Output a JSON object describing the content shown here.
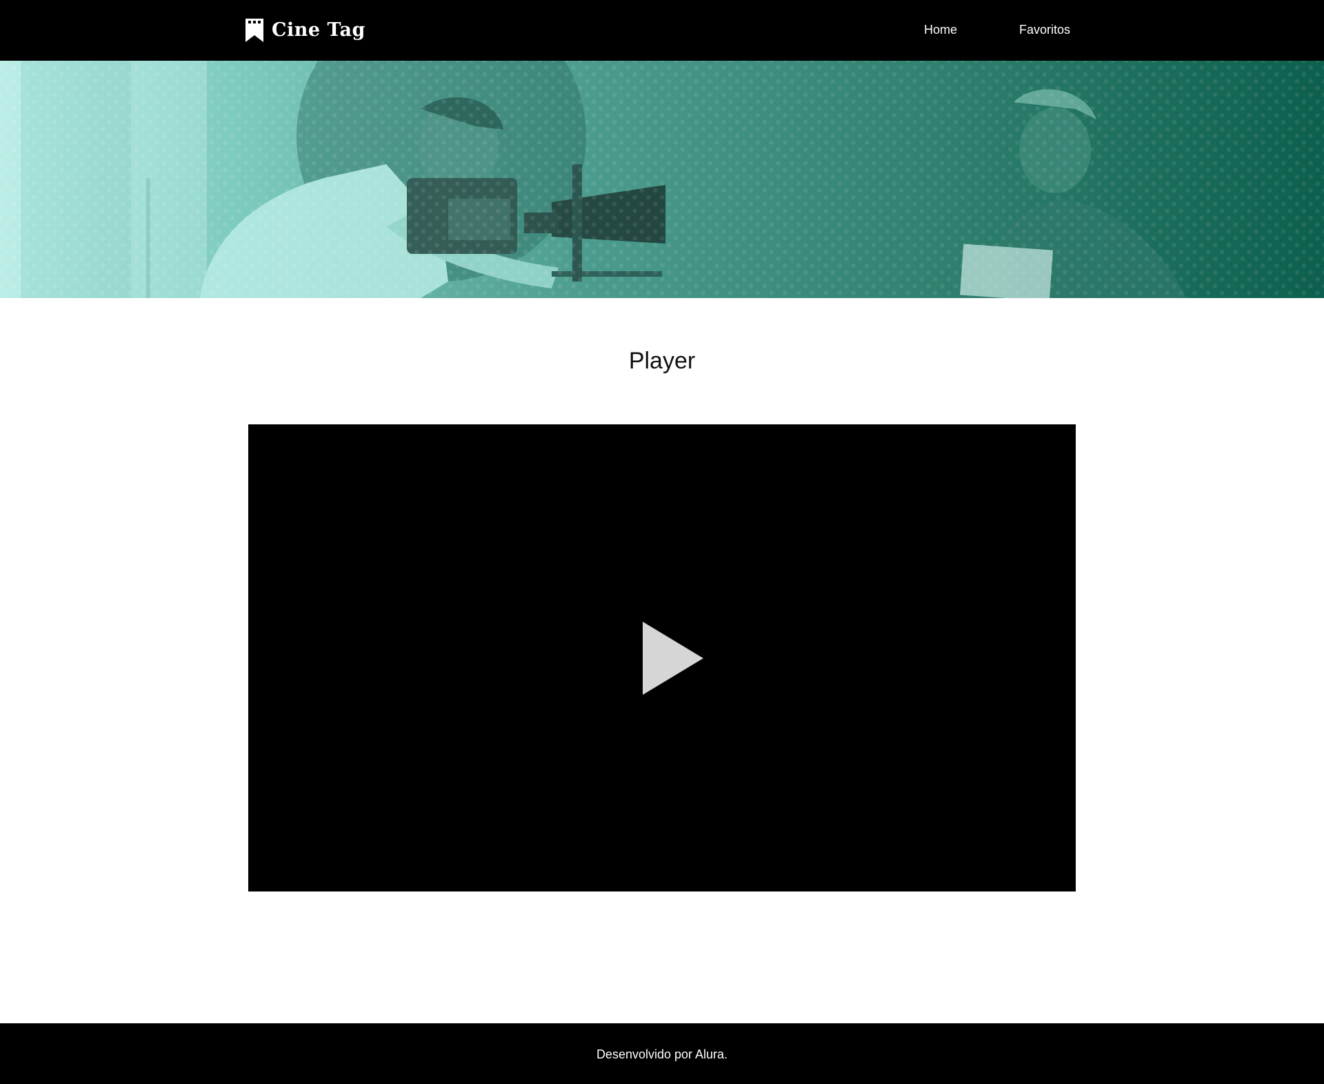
{
  "header": {
    "logo_text": "Cine Tag",
    "nav": [
      {
        "label": "Home"
      },
      {
        "label": "Favoritos"
      }
    ]
  },
  "banner": {
    "image": "man-with-film-camera-and-woman-holding-magazine, teal duotone halftone"
  },
  "main": {
    "title": "Player",
    "video": {
      "play_icon": "play-triangle-icon"
    }
  },
  "footer": {
    "text": "Desenvolvido por Alura."
  },
  "colors": {
    "header_bg": "#000000",
    "banner_light": "#9ee3d8",
    "banner_dark": "#0f6d58",
    "play_icon": "#d6d6d6",
    "footer_bg": "#000000"
  },
  "icons": [
    "bookmark-logo-icon",
    "play-icon"
  ]
}
